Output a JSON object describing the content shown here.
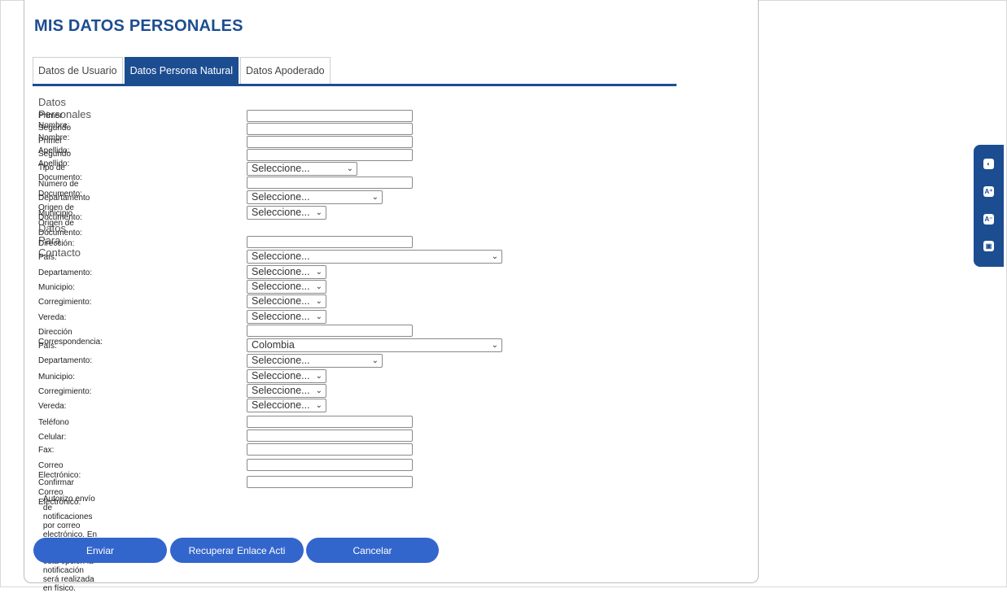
{
  "page": {
    "title": "MIS DATOS PERSONALES"
  },
  "tabs": [
    {
      "label": "Datos de Usuario",
      "active": false
    },
    {
      "label": "Datos Persona Natural",
      "active": true
    },
    {
      "label": "Datos Apoderado",
      "active": false
    }
  ],
  "sections": {
    "personal": "Datos Personales",
    "contact": "Datos Para Contacto"
  },
  "fields": {
    "primer_nombre": {
      "label": "Primer Nombre:",
      "value": ""
    },
    "segundo_nombre": {
      "label": "Segundo Nombre:",
      "value": ""
    },
    "primer_apellido": {
      "label": "Primer Apellido:",
      "value": ""
    },
    "segundo_apellido": {
      "label": "Segundo Apellido:",
      "value": ""
    },
    "tipo_documento": {
      "label": "Tipo de Documento:",
      "value": "Seleccione..."
    },
    "numero_documento": {
      "label": "Número de Documento:",
      "value": ""
    },
    "depto_origen": {
      "label": "Departamento Origen de Documento:",
      "value": "Seleccione..."
    },
    "municipio_origen": {
      "label": "Municipio Origen de Documento:",
      "value": "Seleccione..."
    },
    "direccion": {
      "label": "Dirección:",
      "value": ""
    },
    "pais": {
      "label": "País:",
      "value": "Seleccione..."
    },
    "departamento": {
      "label": "Departamento:",
      "value": "Seleccione..."
    },
    "municipio": {
      "label": "Municipio:",
      "value": "Seleccione..."
    },
    "corregimiento": {
      "label": "Corregimiento:",
      "value": "Seleccione..."
    },
    "vereda": {
      "label": "Vereda:",
      "value": "Seleccione..."
    },
    "direccion_corresp": {
      "label": "Dirección Correspondencia:",
      "value": ""
    },
    "pais_corresp": {
      "label": "País:",
      "value": "Colombia"
    },
    "departamento_corresp": {
      "label": "Departamento:",
      "value": "Seleccione..."
    },
    "municipio_corresp": {
      "label": "Municipio:",
      "value": "Seleccione..."
    },
    "corregimiento_corresp": {
      "label": "Corregimiento:",
      "value": "Seleccione..."
    },
    "vereda_corresp": {
      "label": "Vereda:",
      "value": "Seleccione..."
    },
    "telefono": {
      "label": "Teléfono",
      "value": ""
    },
    "celular": {
      "label": "Celular:",
      "value": ""
    },
    "fax": {
      "label": "Fax:",
      "value": ""
    },
    "correo": {
      "label": "Correo Electrónico:",
      "value": ""
    },
    "confirmar_correo": {
      "label": "Confirmar Correo Electrónico:",
      "value": ""
    }
  },
  "consent": {
    "checked": false,
    "label": "Autorizo envío de notificaciones por correo electrónico. En caso de no seleccionar esta opción la notificación será realizada en físico."
  },
  "buttons": {
    "enviar": "Enviar",
    "recuperar": "Recuperar Enlace Acti",
    "cancelar": "Cancelar"
  },
  "accessibility": {
    "icons": [
      "contrast-icon",
      "increase-font-icon",
      "decrease-font-icon",
      "sign-language-icon"
    ],
    "glyphs": [
      "◐",
      "A⁺",
      "A⁻",
      "▣"
    ]
  },
  "colors": {
    "brand": "#1c4d91",
    "button": "#3366cc"
  }
}
